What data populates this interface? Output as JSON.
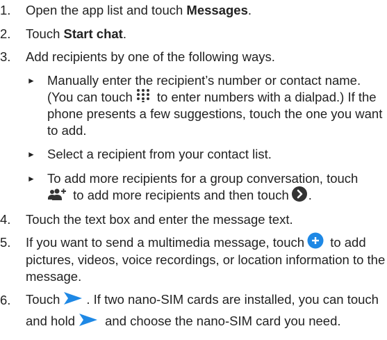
{
  "steps": [
    {
      "num": "1.",
      "pre": "Open the app list and touch ",
      "bold": "Messages",
      "post": "."
    },
    {
      "num": "2.",
      "pre": "Touch ",
      "bold": "Start chat",
      "post": "."
    },
    {
      "num": "3.",
      "text": "Add recipients by one of the following ways."
    },
    {
      "num": "4.",
      "text": "Touch the text box and enter the message text."
    },
    {
      "num": "5.",
      "pre": "If you want to send a multimedia message, touch",
      "post": " to add pictures, videos, voice recordings, or location information to the message."
    },
    {
      "num": "6.",
      "pre": "Touch",
      "mid": ". If two nano-SIM cards are installed, you can touch and hold",
      "post": " and choose the nano-SIM card you need."
    }
  ],
  "substeps": [
    {
      "bullet": "►",
      "pre": "Manually enter the recipient’s number or contact name. (You can touch",
      "post": " to enter numbers with a dialpad.) If the phone presents a few suggestions, touch the one you want to add."
    },
    {
      "bullet": "►",
      "text": "Select a recipient from your contact list."
    },
    {
      "bullet": "►",
      "pre": "To add more recipients for a group conversation, touch",
      "mid": " to add more recipients and then touch",
      "post": "."
    }
  ],
  "icons": {
    "dialpad": "dialpad-icon",
    "add_people": "add-people-icon",
    "next": "next-arrow-icon",
    "attach": "plus-circle-icon",
    "send": "send-icon"
  },
  "colors": {
    "text": "#222222",
    "blue": "#1e88e5",
    "dark": "#333333"
  }
}
